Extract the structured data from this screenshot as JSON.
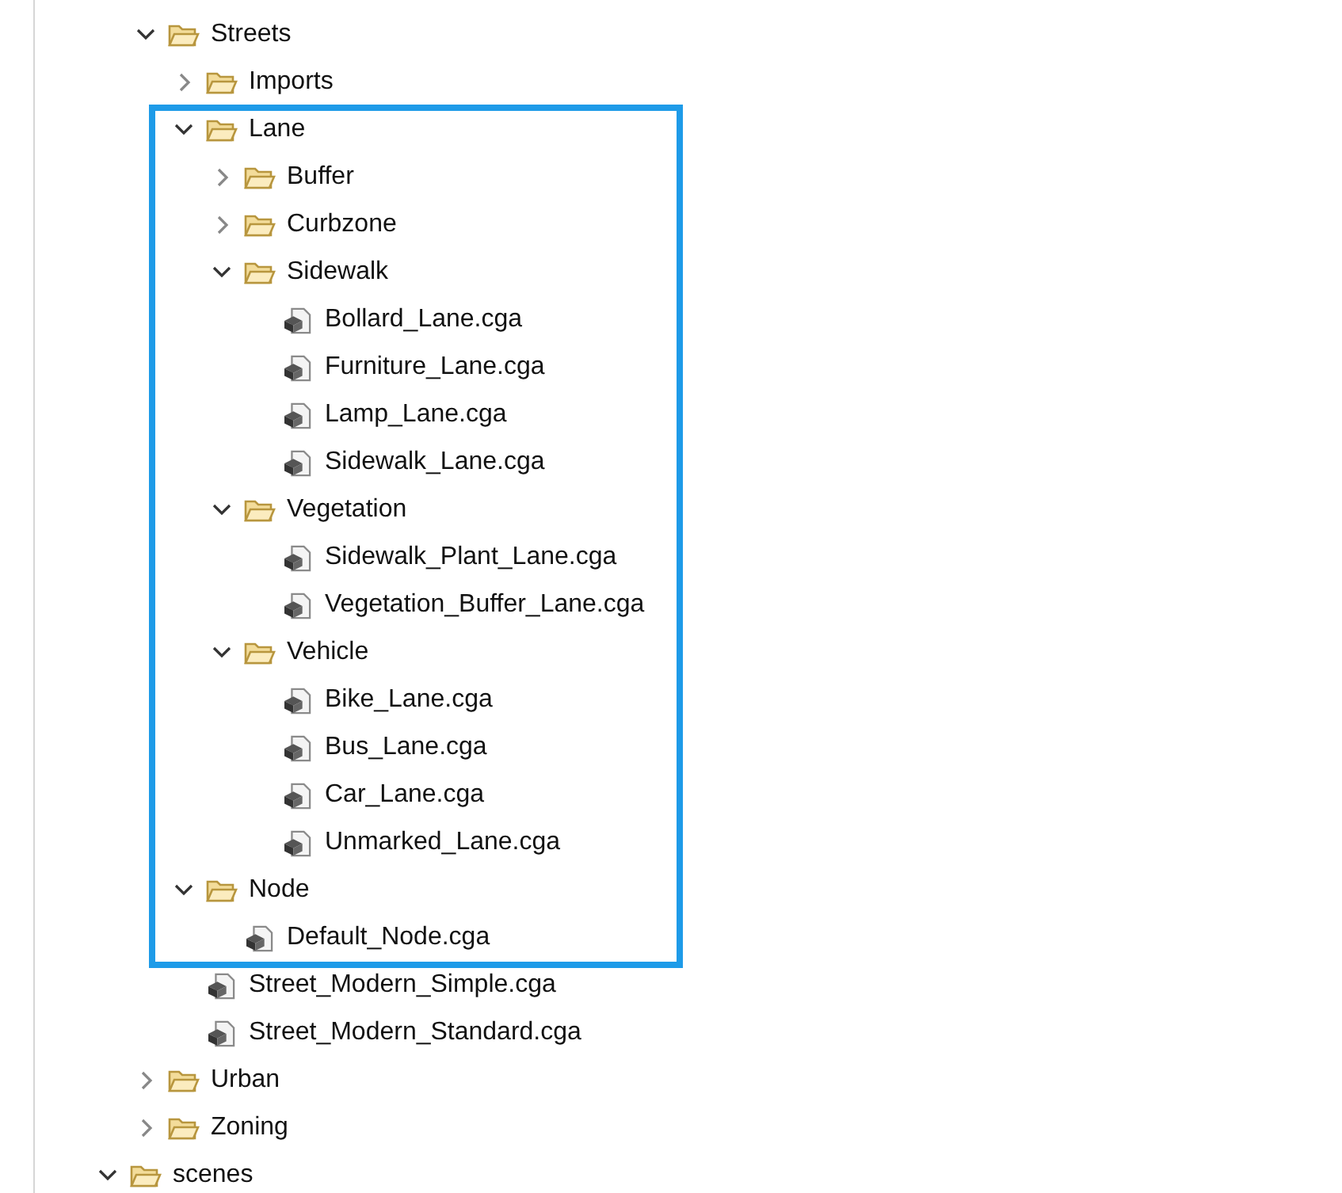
{
  "tree": [
    {
      "kind": "offscreen",
      "children": [
        {
          "kind": "folder",
          "label": "Streets",
          "expanded": true,
          "children": [
            {
              "kind": "folder",
              "label": "Imports",
              "expanded": false
            },
            {
              "kind": "folder",
              "label": "Lane",
              "expanded": true,
              "highlighted": true,
              "children": [
                {
                  "kind": "folder",
                  "label": "Buffer",
                  "expanded": false
                },
                {
                  "kind": "folder",
                  "label": "Curbzone",
                  "expanded": false
                },
                {
                  "kind": "folder",
                  "label": "Sidewalk",
                  "expanded": true,
                  "children": [
                    {
                      "kind": "file",
                      "label": "Bollard_Lane.cga"
                    },
                    {
                      "kind": "file",
                      "label": "Furniture_Lane.cga"
                    },
                    {
                      "kind": "file",
                      "label": "Lamp_Lane.cga"
                    },
                    {
                      "kind": "file",
                      "label": "Sidewalk_Lane.cga"
                    }
                  ]
                },
                {
                  "kind": "folder",
                  "label": "Vegetation",
                  "expanded": true,
                  "children": [
                    {
                      "kind": "file",
                      "label": "Sidewalk_Plant_Lane.cga"
                    },
                    {
                      "kind": "file",
                      "label": "Vegetation_Buffer_Lane.cga"
                    }
                  ]
                },
                {
                  "kind": "folder",
                  "label": "Vehicle",
                  "expanded": true,
                  "children": [
                    {
                      "kind": "file",
                      "label": "Bike_Lane.cga"
                    },
                    {
                      "kind": "file",
                      "label": "Bus_Lane.cga"
                    },
                    {
                      "kind": "file",
                      "label": "Car_Lane.cga"
                    },
                    {
                      "kind": "file",
                      "label": "Unmarked_Lane.cga"
                    }
                  ]
                }
              ]
            },
            {
              "kind": "folder",
              "label": "Node",
              "expanded": true,
              "highlighted": true,
              "children": [
                {
                  "kind": "file",
                  "label": "Default_Node.cga"
                }
              ]
            },
            {
              "kind": "file",
              "label": "Street_Modern_Simple.cga"
            },
            {
              "kind": "file",
              "label": "Street_Modern_Standard.cga"
            }
          ]
        },
        {
          "kind": "folder",
          "label": "Urban",
          "expanded": false
        },
        {
          "kind": "folder",
          "label": "Zoning",
          "expanded": false
        }
      ]
    },
    {
      "kind": "folder",
      "label": "scenes",
      "expanded": true
    }
  ]
}
